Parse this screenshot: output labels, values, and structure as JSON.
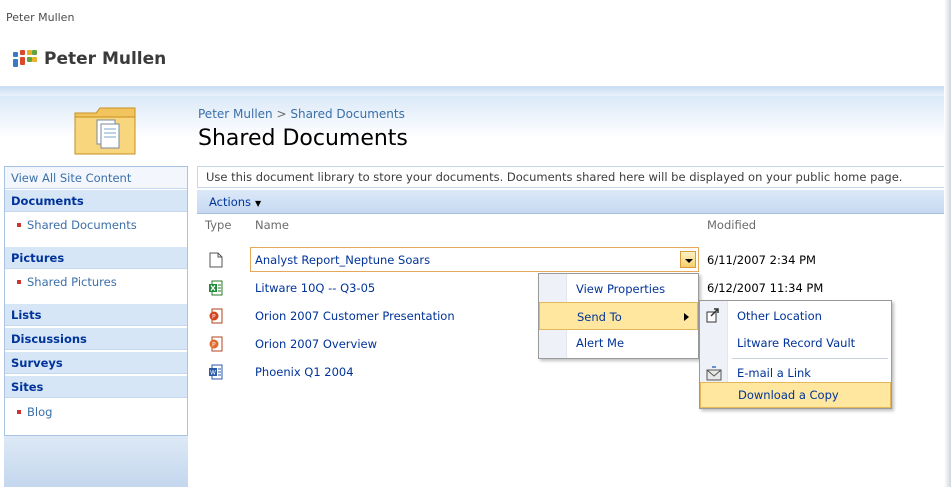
{
  "topbar": {
    "user_name": "Peter Mullen"
  },
  "site": {
    "title": "Peter Mullen",
    "logo_icon": "people-icon"
  },
  "breadcrumb": {
    "parent": "Peter Mullen",
    "separator": " > ",
    "current": "Shared Documents"
  },
  "page": {
    "title": "Shared Documents",
    "folder_icon": "document-library-folder-icon"
  },
  "left_nav": {
    "view_all": "View All Site Content",
    "sections": [
      {
        "heading": "Documents",
        "items": [
          "Shared Documents"
        ]
      },
      {
        "heading": "Pictures",
        "items": [
          "Shared Pictures"
        ]
      },
      {
        "heading": "Lists",
        "items": []
      },
      {
        "heading": "Discussions",
        "items": []
      },
      {
        "heading": "Surveys",
        "items": []
      },
      {
        "heading": "Sites",
        "items": [
          "Blog"
        ]
      }
    ]
  },
  "library": {
    "description": "Use this document library to store your documents. Documents shared here will be displayed on your public home page.",
    "actions_label": "Actions",
    "columns": {
      "type": "Type",
      "name": "Name",
      "modified": "Modified"
    },
    "rows": [
      {
        "icon": "text-file-icon",
        "name": "Analyst Report_Neptune Soars",
        "modified": "6/11/2007 2:34 PM"
      },
      {
        "icon": "excel-file-icon",
        "name": "Litware 10Q -- Q3-05",
        "modified": "6/12/2007 11:34 PM"
      },
      {
        "icon": "powerpoint-file-icon",
        "name": "Orion 2007 Customer Presentation",
        "modified": ""
      },
      {
        "icon": "powerpoint-file-icon",
        "name": "Orion 2007 Overview",
        "modified": ""
      },
      {
        "icon": "word-file-icon",
        "name": "Phoenix Q1 2004",
        "modified": ""
      }
    ]
  },
  "context_menu": {
    "items": [
      "View Properties",
      "Send To",
      "Alert Me"
    ]
  },
  "send_to_menu": {
    "items": [
      "Other Location",
      "Litware Record Vault",
      "E-mail a Link",
      "Download a Copy"
    ]
  },
  "colors": {
    "accent": "#003399",
    "highlight": "#ffe7a0",
    "nav_header": "#d6e6f7"
  }
}
